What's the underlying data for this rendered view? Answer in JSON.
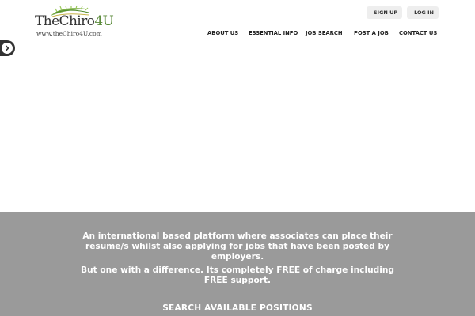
{
  "brand": {
    "name_main": "TheChiro",
    "name_accent": "4U",
    "url": "www.theChiro4U.com",
    "accent_color": "#5a8a3a"
  },
  "auth": {
    "signup_label": "SIGN UP",
    "signup_icon": "user-icon",
    "login_label": "LOG IN",
    "login_icon": "lock-icon"
  },
  "nav": {
    "items": [
      {
        "label": "ABOUT US"
      },
      {
        "label": "ESSENTIAL INFO"
      },
      {
        "label": "JOB SEARCH"
      },
      {
        "label": "POST A JOB"
      },
      {
        "label": "CONTACT US"
      }
    ]
  },
  "slider": {
    "next_icon": "chevron-right-icon"
  },
  "band": {
    "paragraph_1": "An international based platform where associates can place their resume/s whilst also applying for jobs that have been posted by employers.",
    "paragraph_2": "But one with a difference. Its completely FREE of charge including FREE support.",
    "search_heading": "SEARCH AVAILABLE POSITIONS",
    "background_color": "#9a9a9a"
  }
}
